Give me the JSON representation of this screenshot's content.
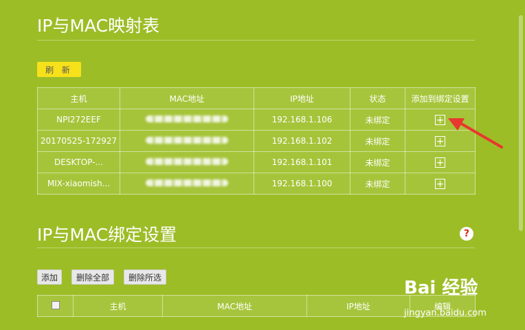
{
  "mapping": {
    "title": "IP与MAC映射表",
    "refresh_label": "刷 新",
    "columns": [
      "主机",
      "MAC地址",
      "IP地址",
      "状态",
      "添加到绑定设置"
    ],
    "rows": [
      {
        "host": "NPI272EEF",
        "ip": "192.168.1.106",
        "status": "未绑定",
        "action_icon": "plus-icon"
      },
      {
        "host": "20170525-172927",
        "ip": "192.168.1.102",
        "status": "未绑定",
        "action_icon": "plus-icon"
      },
      {
        "host": "DESKTOP-...",
        "ip": "192.168.1.101",
        "status": "未绑定",
        "action_icon": "plus-icon"
      },
      {
        "host": "MIX-xiaomish...",
        "ip": "192.168.1.100",
        "status": "未绑定",
        "action_icon": "plus-icon"
      }
    ]
  },
  "binding": {
    "title": "IP与MAC绑定设置",
    "help_label": "?",
    "buttons": {
      "add": "添加",
      "delete_all": "删除全部",
      "delete_selected": "删除所选"
    },
    "columns": [
      "主机",
      "MAC地址",
      "IP地址",
      "编辑"
    ]
  },
  "watermark": {
    "main": "Bai 经验",
    "sub": "jingyan.baidu.com"
  },
  "colors": {
    "background": "#9dbd27",
    "refresh_button": "#f7e11a",
    "arrow": "#e8382f",
    "help_icon": "#d0301b"
  }
}
